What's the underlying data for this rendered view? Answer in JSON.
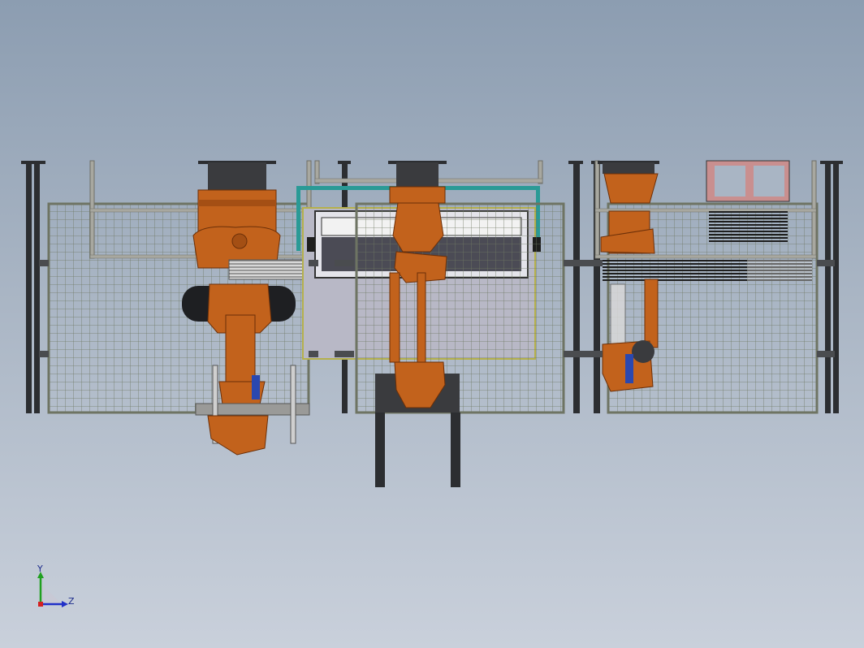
{
  "viewport": {
    "background": "#a9b5c4"
  },
  "colors": {
    "robot": "#c2621c",
    "robot_dark": "#6b2f08",
    "fence_frame": "#6e7463",
    "mesh": "#707a64",
    "post": "#2c2e31",
    "rail": "#8e8e86",
    "teal_rail": "#2a9a96",
    "panel": "#b8b8c6",
    "pink_frame": "#c98f8f"
  },
  "triad": {
    "y_label": "Y",
    "z_label": "Z",
    "x_axis_color": "#d42020",
    "y_axis_color": "#20a020",
    "z_axis_color": "#2030c8"
  }
}
